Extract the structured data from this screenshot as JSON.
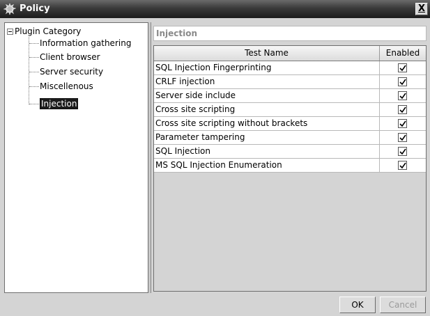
{
  "window": {
    "title": "Policy",
    "close_label": "X",
    "icon": "policy-app-icon"
  },
  "tree": {
    "root_label": "Plugin Category",
    "root_expanded": true,
    "children": [
      {
        "label": "Information gathering",
        "selected": false
      },
      {
        "label": "Client browser",
        "selected": false
      },
      {
        "label": "Server security",
        "selected": false
      },
      {
        "label": "Miscellenous",
        "selected": false
      },
      {
        "label": "Injection",
        "selected": true
      }
    ]
  },
  "panel": {
    "category_title": "Injection"
  },
  "table": {
    "columns": [
      "Test Name",
      "Enabled"
    ],
    "rows": [
      {
        "name": "SQL Injection Fingerprinting",
        "enabled": true
      },
      {
        "name": "CRLF injection",
        "enabled": true
      },
      {
        "name": "Server side include",
        "enabled": true
      },
      {
        "name": "Cross site scripting",
        "enabled": true
      },
      {
        "name": "Cross site scripting without brackets",
        "enabled": true
      },
      {
        "name": "Parameter tampering",
        "enabled": true
      },
      {
        "name": "SQL Injection",
        "enabled": true
      },
      {
        "name": "MS SQL Injection Enumeration",
        "enabled": true
      }
    ]
  },
  "buttons": {
    "ok_label": "OK",
    "cancel_label": "Cancel",
    "cancel_enabled": false
  },
  "colors": {
    "selection_bg": "#1c1c1c",
    "title_text": "#ffffff",
    "disabled_text": "#9a9a9a"
  }
}
